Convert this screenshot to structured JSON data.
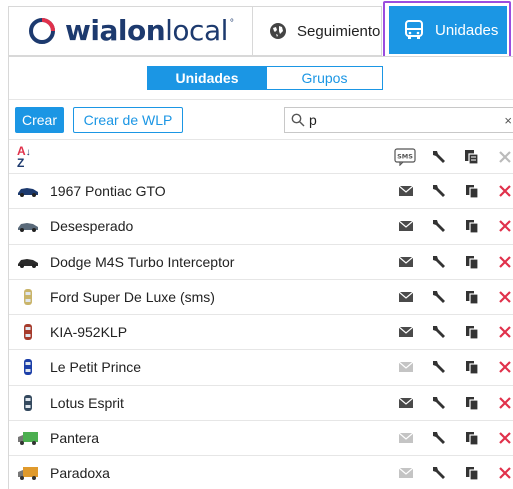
{
  "header": {
    "logo": {
      "brand_bold": "wialon",
      "brand_light": "local",
      "tm": "°"
    },
    "nav": [
      {
        "label": "Seguimiento",
        "icon": "globe-icon",
        "active": false
      },
      {
        "label": "Unidades",
        "icon": "bus-icon",
        "active": true
      }
    ]
  },
  "colors": {
    "accent": "#1b96e4",
    "highlight_outline": "#9b4dde",
    "delete": "#e0314b",
    "brand": "#1d3a6e"
  },
  "panel": {
    "tabs": [
      {
        "label": "Unidades",
        "active": true
      },
      {
        "label": "Grupos",
        "active": false
      }
    ],
    "toolbar": {
      "create_label": "Crear",
      "wlp_label": "Crear de WLP",
      "search_value": "p",
      "clear_glyph": "×"
    },
    "list_header": {
      "sort_top": "A",
      "sort_bottom": "Z",
      "icons": [
        "sms-icon",
        "wrench-icon",
        "copy-icon",
        "close-icon"
      ]
    },
    "units": [
      {
        "name": "1967 Pontiac GTO",
        "icon": "car-icon",
        "sms_enabled": true
      },
      {
        "name": "Desesperado",
        "icon": "car-icon",
        "sms_enabled": true
      },
      {
        "name": "Dodge M4S Turbo Interceptor",
        "icon": "car-icon",
        "sms_enabled": true
      },
      {
        "name": "Ford Super De Luxe (sms)",
        "icon": "car-icon",
        "sms_enabled": true
      },
      {
        "name": "KIA-952KLP",
        "icon": "car-icon",
        "sms_enabled": true
      },
      {
        "name": "Le Petit Prince",
        "icon": "car-icon",
        "sms_enabled": false
      },
      {
        "name": "Lotus Esprit",
        "icon": "car-icon",
        "sms_enabled": true
      },
      {
        "name": "Pantera",
        "icon": "truck-icon",
        "sms_enabled": false
      },
      {
        "name": "Paradoxa",
        "icon": "truck-icon",
        "sms_enabled": false
      }
    ]
  }
}
